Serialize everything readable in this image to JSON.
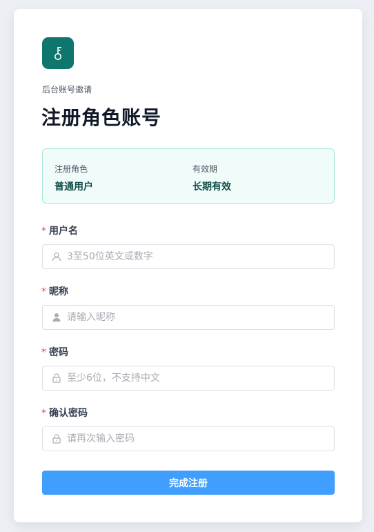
{
  "header": {
    "subtitle": "后台账号邀请",
    "title": "注册角色账号"
  },
  "info": {
    "role_label": "注册角色",
    "role_value": "普通用户",
    "validity_label": "有效期",
    "validity_value": "长期有效"
  },
  "form": {
    "required_mark": "*",
    "username": {
      "label": "用户名",
      "placeholder": "3至50位英文或数字",
      "value": "",
      "icon": "user-outline-icon"
    },
    "nickname": {
      "label": "昵称",
      "placeholder": "请输入昵称",
      "value": "",
      "icon": "user-filled-icon"
    },
    "password": {
      "label": "密码",
      "placeholder": "至少6位，不支持中文",
      "value": "",
      "icon": "lock-icon"
    },
    "confirm_password": {
      "label": "确认密码",
      "placeholder": "请再次输入密码",
      "value": "",
      "icon": "lock-icon"
    },
    "submit_label": "完成注册"
  },
  "colors": {
    "brand": "#0f766e",
    "primary_button": "#409eff",
    "required": "#ef4444",
    "info_bg": "#effcf9",
    "info_border": "#a7e7dc"
  }
}
